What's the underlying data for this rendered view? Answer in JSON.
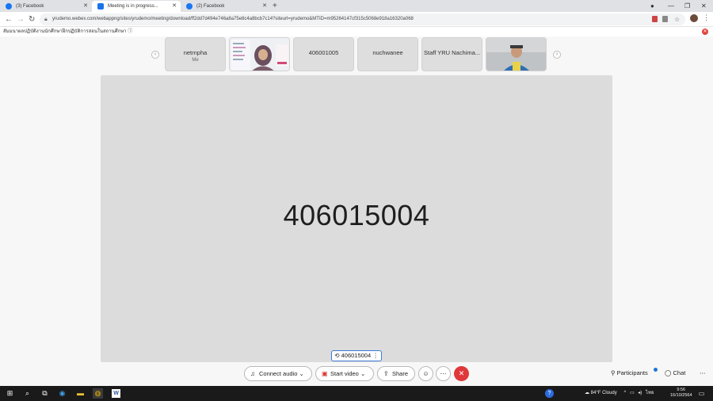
{
  "browser": {
    "tabs": [
      {
        "title": "(3) Facebook",
        "icon": "facebook-icon",
        "color": "#1877f2"
      },
      {
        "title": "Meeting is in progress...",
        "icon": "webex-icon",
        "color": "#1a73e8"
      },
      {
        "title": "(2) Facebook",
        "icon": "facebook-icon",
        "color": "#1877f2"
      }
    ],
    "url": "yrudemo.webex.com/webappng/sites/yrudemo/meeting/download/ff2dd7d494e746a8a75e8c4a8bcb7c14?siteurl=yrudemo&MTID=m95264147cf315c5068e918a16320a068"
  },
  "banner": {
    "text": "สัมมนาผลปฏิบัติงานนักศึกษาฝึกปฏิบัติการสอนในสถานศึกษา"
  },
  "participants_strip": [
    {
      "name": "netrnpha",
      "sub": "Me",
      "type": "name"
    },
    {
      "name": "",
      "sub": "",
      "type": "video-woman"
    },
    {
      "name": "406001005",
      "sub": "",
      "type": "name"
    },
    {
      "name": "nuchwanee",
      "sub": "",
      "type": "name"
    },
    {
      "name": "Staff YRU Nachima...",
      "sub": "",
      "type": "name"
    },
    {
      "name": "",
      "sub": "",
      "type": "video-man"
    }
  ],
  "stage": {
    "name": "406015004",
    "pill": "406015004"
  },
  "controls": {
    "connect_audio": "Connect audio",
    "start_video": "Start video",
    "share": "Share",
    "participants": "Participants",
    "chat": "Chat"
  },
  "taskbar": {
    "weather": "84°F  Cloudy",
    "lang": "ไทย",
    "time": "9:56",
    "date": "16/10/2564"
  },
  "colors": {
    "leave": "#e0373a",
    "accent": "#3d7bd6"
  }
}
